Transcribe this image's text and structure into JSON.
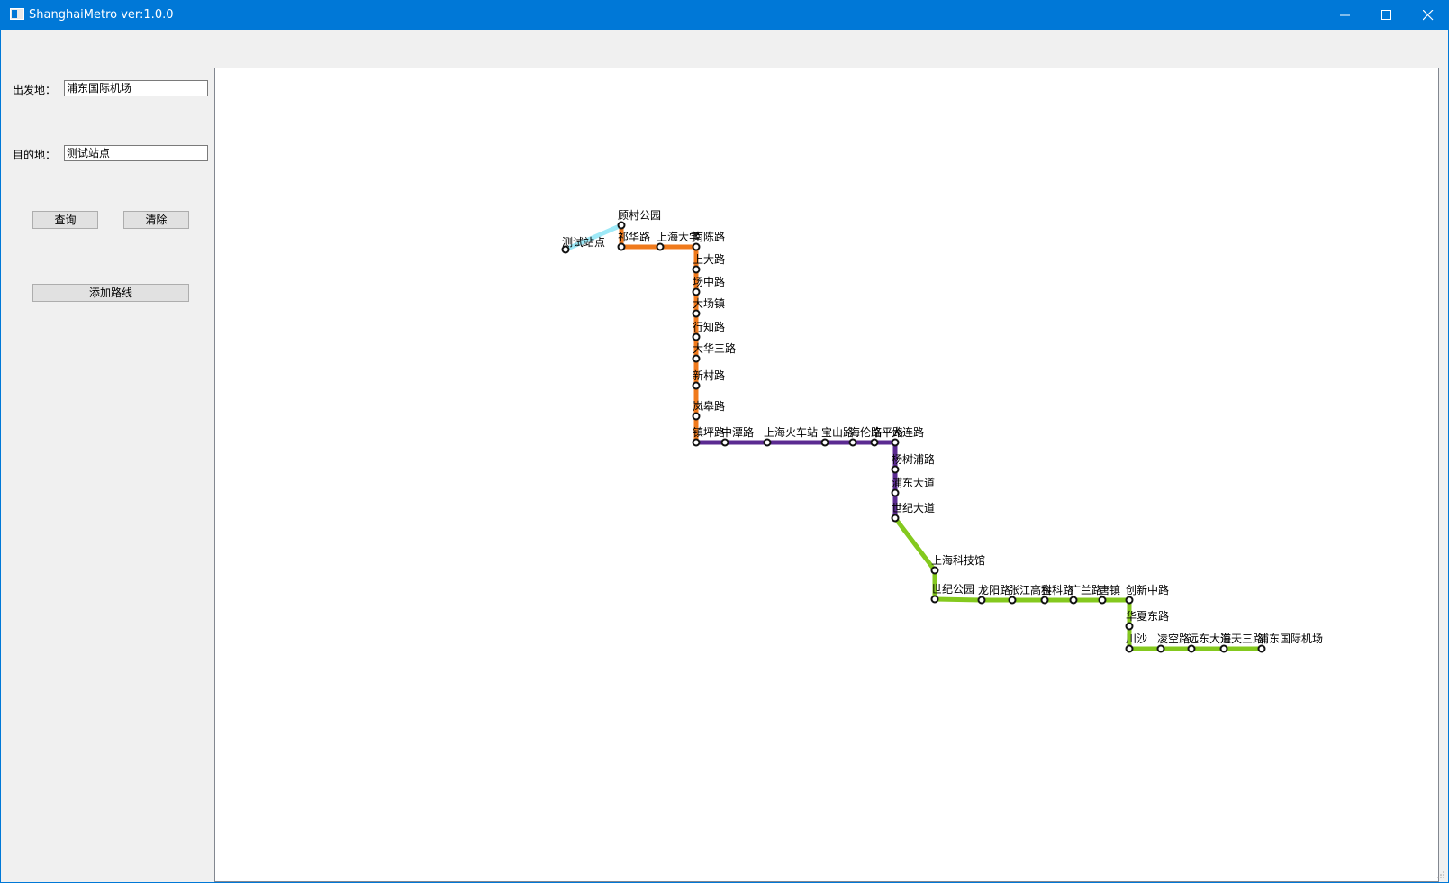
{
  "window": {
    "title": "ShanghaiMetro ver:1.0.0"
  },
  "form": {
    "origin_label": "出发地：",
    "origin_value": "浦东国际机场",
    "dest_label": "目的地：",
    "dest_value": "测试站点",
    "query_label": "查询",
    "clear_label": "清除",
    "add_route_label": "添加路线"
  },
  "map": {
    "stations": [
      {
        "id": "s0",
        "name": "测试站点"
      },
      {
        "id": "s1",
        "name": "顾村公园"
      },
      {
        "id": "s2",
        "name": "祁华路"
      },
      {
        "id": "s3",
        "name": "上海大学"
      },
      {
        "id": "s4",
        "name": "南陈路"
      },
      {
        "id": "s5",
        "name": "上大路"
      },
      {
        "id": "s6",
        "name": "场中路"
      },
      {
        "id": "s7",
        "name": "大场镇"
      },
      {
        "id": "s8",
        "name": "行知路"
      },
      {
        "id": "s9",
        "name": "大华三路"
      },
      {
        "id": "s10",
        "name": "新村路"
      },
      {
        "id": "s11",
        "name": "岚皋路"
      },
      {
        "id": "s12",
        "name": "镇坪路"
      },
      {
        "id": "s13",
        "name": "中潭路"
      },
      {
        "id": "s14",
        "name": "上海火车站"
      },
      {
        "id": "s15",
        "name": "宝山路"
      },
      {
        "id": "s16",
        "name": "海伦路"
      },
      {
        "id": "s17",
        "name": "临平路"
      },
      {
        "id": "s18",
        "name": "大连路"
      },
      {
        "id": "s19",
        "name": "杨树浦路"
      },
      {
        "id": "s20",
        "name": "浦东大道"
      },
      {
        "id": "s21",
        "name": "世纪大道"
      },
      {
        "id": "s22",
        "name": "上海科技馆"
      },
      {
        "id": "s23",
        "name": "世纪公园"
      },
      {
        "id": "s24",
        "name": "龙阳路"
      },
      {
        "id": "s25",
        "name": "张江高科"
      },
      {
        "id": "s26",
        "name": "金科路"
      },
      {
        "id": "s27",
        "name": "广兰路"
      },
      {
        "id": "s28",
        "name": "唐镇"
      },
      {
        "id": "s29",
        "name": "创新中路"
      },
      {
        "id": "s30",
        "name": "华夏东路"
      },
      {
        "id": "s31",
        "name": "川沙"
      },
      {
        "id": "s32",
        "name": "凌空路"
      },
      {
        "id": "s33",
        "name": "远东大道"
      },
      {
        "id": "s34",
        "name": "海天三路"
      },
      {
        "id": "s35",
        "name": "浦东国际机场"
      }
    ],
    "lines": [
      {
        "color": "#9ee9f7",
        "stations": [
          "s0",
          "s1"
        ]
      },
      {
        "color": "#f07a1c",
        "stations": [
          "s1",
          "s2",
          "s3",
          "s4",
          "s5",
          "s6",
          "s7",
          "s8",
          "s9",
          "s10",
          "s11",
          "s12"
        ]
      },
      {
        "color": "#5b2a91",
        "stations": [
          "s12",
          "s13",
          "s14",
          "s15",
          "s16",
          "s17",
          "s18",
          "s19",
          "s20",
          "s21"
        ]
      },
      {
        "color": "#84c91e",
        "stations": [
          "s21",
          "s22",
          "s23",
          "s24",
          "s25",
          "s26",
          "s27",
          "s28",
          "s29",
          "s30",
          "s31",
          "s32",
          "s33",
          "s34",
          "s35"
        ]
      }
    ]
  }
}
